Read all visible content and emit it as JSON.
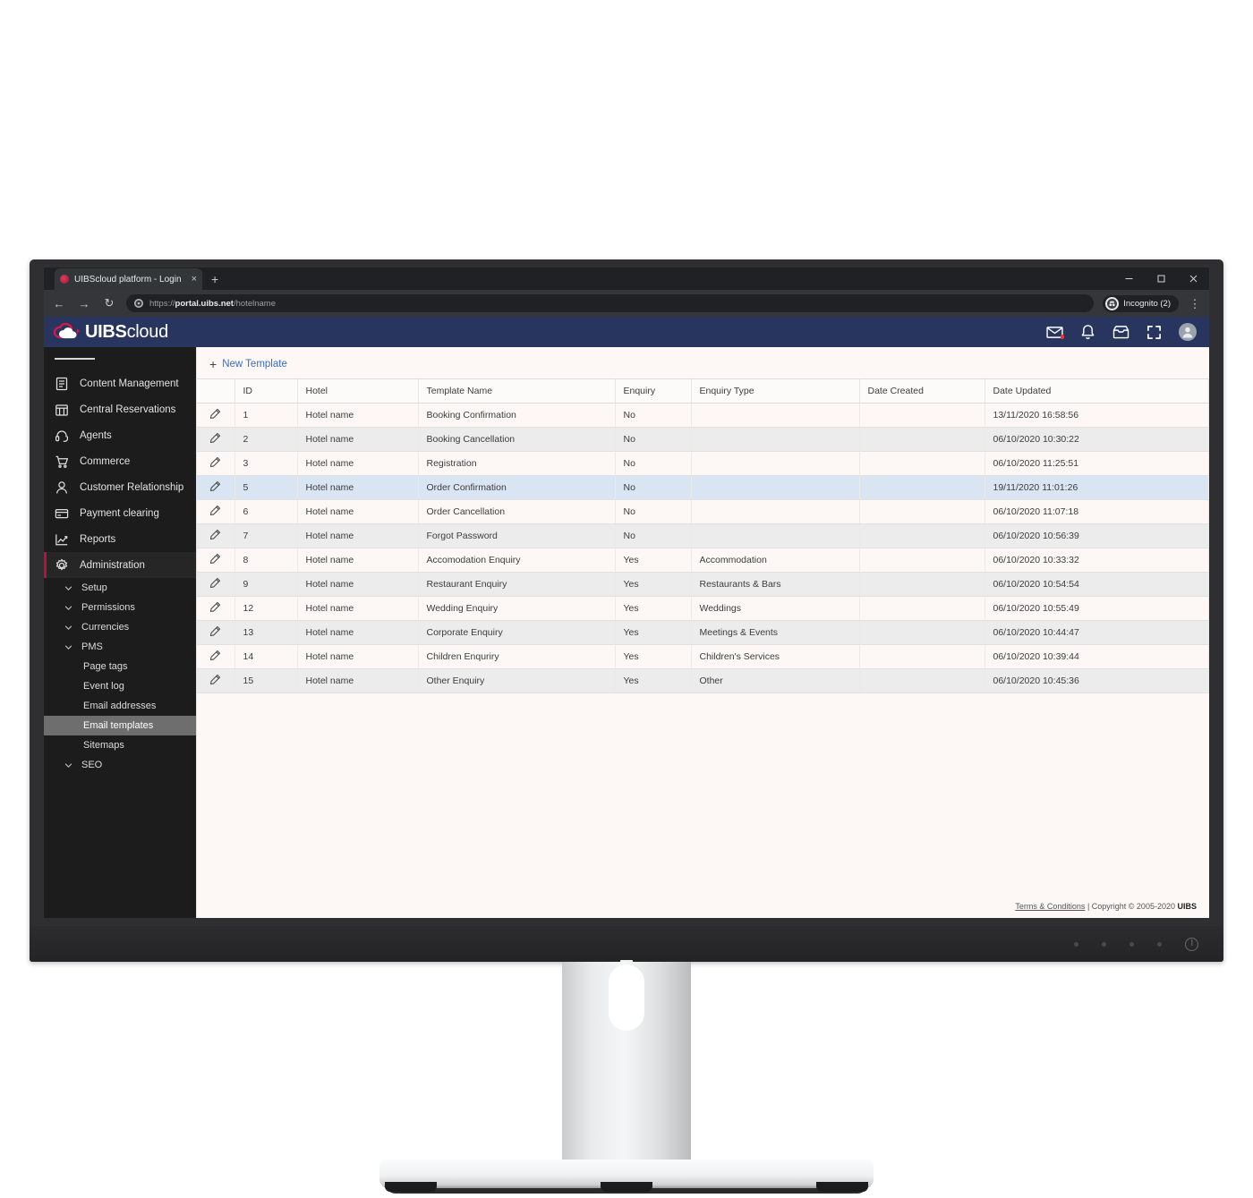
{
  "browser": {
    "tab": {
      "title": "UIBScloud platform - Login",
      "favicon": "uibs-favicon",
      "close": "×"
    },
    "newtab_label": "+",
    "window_controls": {
      "minimize": "minimize-icon",
      "maximize": "maximize-icon",
      "close": "close-icon"
    },
    "nav": {
      "back": "←",
      "forward": "→",
      "reload": "↻"
    },
    "url": {
      "scheme": "https://",
      "host": "portal.uibs.net",
      "path": "/hotelname",
      "full": "https://portal.uibs.net/hotelname"
    },
    "profile": {
      "label": "Incognito (2)",
      "icon": "incognito-icon"
    },
    "menu": "⋮"
  },
  "appbar": {
    "logo_prefix": "UIBS",
    "logo_suffix": "cloud",
    "icons": [
      "mail-icon",
      "bell-icon",
      "inbox-icon",
      "fullscreen-icon",
      "avatar-icon"
    ]
  },
  "sidebar": {
    "toggle": "hamburger-icon",
    "items": [
      {
        "label": "Content Management",
        "icon": "document-icon",
        "active": false
      },
      {
        "label": "Central Reservations",
        "icon": "calendar-icon",
        "active": false
      },
      {
        "label": "Agents",
        "icon": "headset-icon",
        "active": false
      },
      {
        "label": "Commerce",
        "icon": "cart-icon",
        "active": false
      },
      {
        "label": "Customer Relationship",
        "icon": "person-icon",
        "active": false
      },
      {
        "label": "Payment clearing",
        "icon": "card-icon",
        "active": false
      },
      {
        "label": "Reports",
        "icon": "chart-icon",
        "active": false
      },
      {
        "label": "Administration",
        "icon": "gear-icon",
        "active": true
      }
    ],
    "subitems": [
      {
        "label": "Setup",
        "expandable": true,
        "selected": false
      },
      {
        "label": "Permissions",
        "expandable": true,
        "selected": false
      },
      {
        "label": "Currencies",
        "expandable": true,
        "selected": false
      },
      {
        "label": "PMS",
        "expandable": true,
        "selected": false
      },
      {
        "label": "Page tags",
        "expandable": false,
        "selected": false
      },
      {
        "label": "Event log",
        "expandable": false,
        "selected": false
      },
      {
        "label": "Email addresses",
        "expandable": false,
        "selected": false
      },
      {
        "label": "Email templates",
        "expandable": false,
        "selected": true
      },
      {
        "label": "Sitemaps",
        "expandable": false,
        "selected": false
      },
      {
        "label": "SEO",
        "expandable": true,
        "selected": false
      }
    ]
  },
  "content": {
    "new_template_label": "New Template",
    "new_template_plus": "+",
    "edit_icon": "pencil-icon",
    "columns": [
      "",
      "ID",
      "Hotel",
      "Template Name",
      "Enquiry",
      "Enquiry Type",
      "Date Created",
      "Date Updated"
    ],
    "rows": [
      {
        "id": "1",
        "hotel": "Hotel name",
        "template": "Booking Confirmation",
        "enquiry": "No",
        "type": "",
        "created": "",
        "updated": "13/11/2020 16:58:56",
        "selected": false
      },
      {
        "id": "2",
        "hotel": "Hotel name",
        "template": "Booking Cancellation",
        "enquiry": "No",
        "type": "",
        "created": "",
        "updated": "06/10/2020 10:30:22",
        "selected": false
      },
      {
        "id": "3",
        "hotel": "Hotel name",
        "template": "Registration",
        "enquiry": "No",
        "type": "",
        "created": "",
        "updated": "06/10/2020 11:25:51",
        "selected": false
      },
      {
        "id": "5",
        "hotel": "Hotel name",
        "template": "Order Confirmation",
        "enquiry": "No",
        "type": "",
        "created": "",
        "updated": "19/11/2020 11:01:26",
        "selected": true
      },
      {
        "id": "6",
        "hotel": "Hotel name",
        "template": "Order Cancellation",
        "enquiry": "No",
        "type": "",
        "created": "",
        "updated": "06/10/2020 11:07:18",
        "selected": false
      },
      {
        "id": "7",
        "hotel": "Hotel name",
        "template": "Forgot Password",
        "enquiry": "No",
        "type": "",
        "created": "",
        "updated": "06/10/2020 10:56:39",
        "selected": false
      },
      {
        "id": "8",
        "hotel": "Hotel name",
        "template": "Accomodation Enquiry",
        "enquiry": "Yes",
        "type": "Accommodation",
        "created": "",
        "updated": "06/10/2020 10:33:32",
        "selected": false
      },
      {
        "id": "9",
        "hotel": "Hotel name",
        "template": "Restaurant Enquiry",
        "enquiry": "Yes",
        "type": "Restaurants & Bars",
        "created": "",
        "updated": "06/10/2020 10:54:54",
        "selected": false
      },
      {
        "id": "12",
        "hotel": "Hotel name",
        "template": "Wedding Enquiry",
        "enquiry": "Yes",
        "type": "Weddings",
        "created": "",
        "updated": "06/10/2020 10:55:49",
        "selected": false
      },
      {
        "id": "13",
        "hotel": "Hotel name",
        "template": "Corporate Enquiry",
        "enquiry": "Yes",
        "type": "Meetings & Events",
        "created": "",
        "updated": "06/10/2020 10:44:47",
        "selected": false
      },
      {
        "id": "14",
        "hotel": "Hotel name",
        "template": "Children Enquriry",
        "enquiry": "Yes",
        "type": "Children's Services",
        "created": "",
        "updated": "06/10/2020 10:39:44",
        "selected": false
      },
      {
        "id": "15",
        "hotel": "Hotel name",
        "template": "Other Enquiry",
        "enquiry": "Yes",
        "type": "Other",
        "created": "",
        "updated": "06/10/2020 10:45:36",
        "selected": false
      }
    ],
    "footer": {
      "terms": "Terms & Conditions",
      "separator": " | ",
      "copyright": "Copyright © 2005-2020 ",
      "brand": "UIBS"
    }
  },
  "monitor": {
    "power_icon": "power-icon",
    "osd_buttons": 4
  },
  "colors": {
    "appbar": "#28355f",
    "accent_link": "#2f6fd0",
    "active_marker": "#b8123c",
    "row_selected": "#d9e5f3",
    "row_odd": "#fdf8f5",
    "row_even": "#ececec"
  }
}
